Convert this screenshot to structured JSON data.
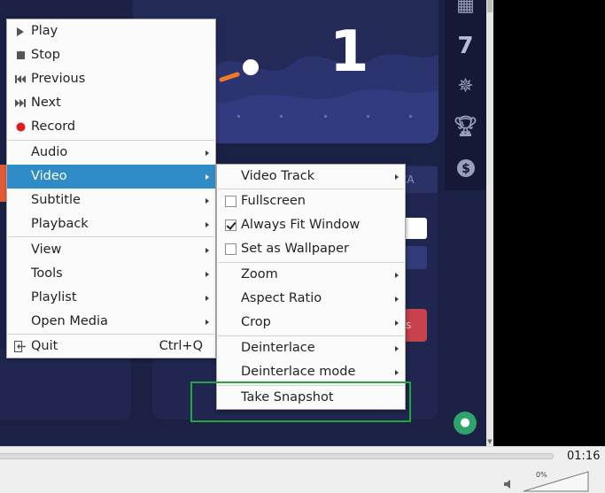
{
  "background": {
    "big_digit": "1",
    "tab_label": "CA",
    "red_button_label": "s"
  },
  "main_menu": {
    "items": [
      {
        "label": "Play",
        "icon": "play-icon"
      },
      {
        "label": "Stop",
        "icon": "stop-icon"
      },
      {
        "label": "Previous",
        "icon": "previous-icon"
      },
      {
        "label": "Next",
        "icon": "next-icon"
      },
      {
        "label": "Record",
        "icon": "record-icon"
      },
      {
        "label": "Audio",
        "submenu": true
      },
      {
        "label": "Video",
        "submenu": true,
        "selected": true
      },
      {
        "label": "Subtitle",
        "submenu": true
      },
      {
        "label": "Playback",
        "submenu": true
      },
      {
        "label": "View",
        "submenu": true
      },
      {
        "label": "Tools",
        "submenu": true
      },
      {
        "label": "Playlist",
        "submenu": true
      },
      {
        "label": "Open Media",
        "submenu": true
      },
      {
        "label": "Quit",
        "icon": "quit-icon",
        "shortcut": "Ctrl+Q"
      }
    ]
  },
  "video_menu": {
    "items": [
      {
        "label": "Video Track",
        "submenu": true
      },
      {
        "label": "Fullscreen",
        "checked": false
      },
      {
        "label": "Always Fit Window",
        "checked": true
      },
      {
        "label": "Set as Wallpaper",
        "checked": false
      },
      {
        "label": "Zoom",
        "submenu": true
      },
      {
        "label": "Aspect Ratio",
        "submenu": true
      },
      {
        "label": "Crop",
        "submenu": true
      },
      {
        "label": "Deinterlace",
        "submenu": true
      },
      {
        "label": "Deinterlace mode",
        "submenu": true
      },
      {
        "label": "Take Snapshot"
      }
    ]
  },
  "controls": {
    "time": "01:16",
    "volume_label": "0%",
    "volume_level": 0
  },
  "colors": {
    "selection": "#308cc6",
    "record": "#e01b1b",
    "highlight_box": "#1ea93a"
  }
}
